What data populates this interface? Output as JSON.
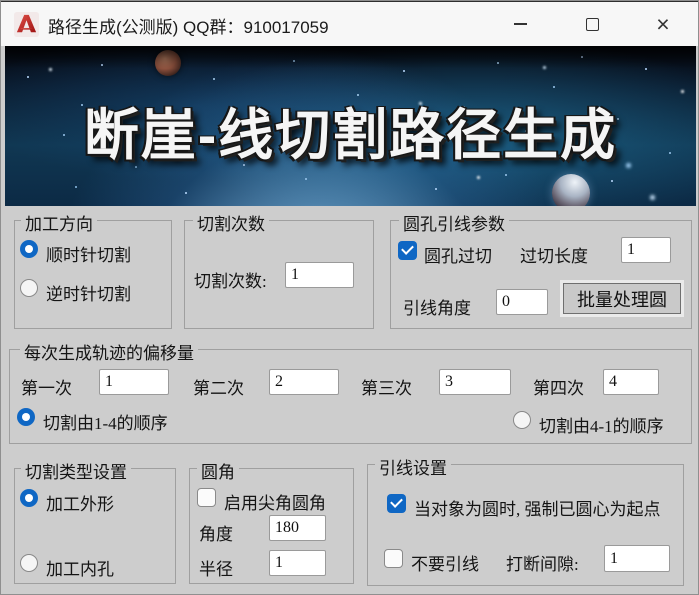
{
  "titlebar": {
    "title": "路径生成(公测版) QQ群：910017059",
    "close_glyph": "×",
    "icons": {
      "app": "autocad-a-logo",
      "minimize": "minus-line",
      "maximize": "square-outline",
      "close": "x-cross"
    }
  },
  "banner": {
    "title": "断崖-线切割路径生成"
  },
  "colors": {
    "accent_blue": "#0f67c4",
    "dialog_bg": "#cdcdcd",
    "titlebar_bg": "#f7f7f7",
    "banner_deep": "#0a1b2e",
    "app_icon_red": "#c01818"
  },
  "direction_group": {
    "title": "加工方向",
    "clockwise": {
      "label": "顺时针切割",
      "selected": true
    },
    "counterclockwise": {
      "label": "逆时针切割",
      "selected": false
    }
  },
  "cut_count_group": {
    "title": "切割次数",
    "label": "切割次数:",
    "value": "1"
  },
  "hole_lead_group": {
    "title": "圆孔引线参数",
    "overcut_checkbox": {
      "label": "圆孔过切",
      "checked": true
    },
    "overcut_length": {
      "label": "过切长度",
      "value": "1"
    },
    "lead_angle": {
      "label": "引线角度",
      "value": "0"
    },
    "batch_button_label": "批量处理圆"
  },
  "offset_group": {
    "title": "每次生成轨迹的偏移量",
    "passes": [
      {
        "label": "第一次",
        "value": "1"
      },
      {
        "label": "第二次",
        "value": "2"
      },
      {
        "label": "第三次",
        "value": "3"
      },
      {
        "label": "第四次",
        "value": "4"
      }
    ],
    "order_1_4": {
      "label": "切割由1-4的顺序",
      "selected": true
    },
    "order_4_1": {
      "label": "切割由4-1的顺序",
      "selected": false
    }
  },
  "cut_type_group": {
    "title": "切割类型设置",
    "outer": {
      "label": "加工外形",
      "selected": true
    },
    "inner": {
      "label": "加工内孔",
      "selected": false
    }
  },
  "fillet_group": {
    "title": "圆角",
    "enable_checkbox": {
      "label": "启用尖角圆角",
      "checked": false
    },
    "angle": {
      "label": "角度",
      "value": "180"
    },
    "radius": {
      "label": "半径",
      "value": "1"
    }
  },
  "lead_group": {
    "title": "引线设置",
    "circle_center_checkbox": {
      "label": "当对象为圆时, 强制已圆心为起点",
      "checked": true
    },
    "no_lead_checkbox": {
      "label": "不要引线",
      "checked": false
    },
    "break_gap": {
      "label": "打断间隙:",
      "value": "1"
    }
  }
}
